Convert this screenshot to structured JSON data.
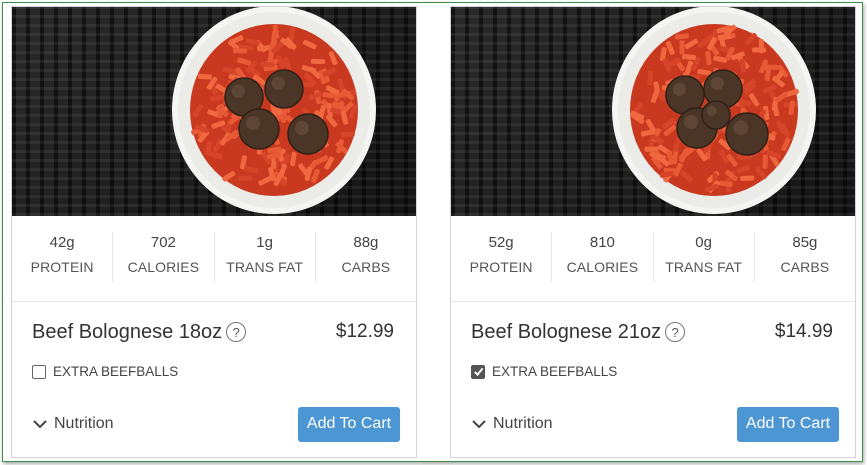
{
  "products": [
    {
      "stats": [
        {
          "value": "42g",
          "label": "PROTEIN"
        },
        {
          "value": "702",
          "label": "CALORIES"
        },
        {
          "value": "1g",
          "label": "TRANS FAT"
        },
        {
          "value": "88g",
          "label": "CARBS"
        }
      ],
      "name": "Beef Bolognese 18oz",
      "help_glyph": "?",
      "price": "$12.99",
      "option_label": "EXTRA BEEFBALLS",
      "option_checked": false,
      "nutrition_label": "Nutrition",
      "add_to_cart_label": "Add To Cart",
      "meatball_count": 4
    },
    {
      "stats": [
        {
          "value": "52g",
          "label": "PROTEIN"
        },
        {
          "value": "810",
          "label": "CALORIES"
        },
        {
          "value": "0g",
          "label": "TRANS FAT"
        },
        {
          "value": "85g",
          "label": "CARBS"
        }
      ],
      "name": "Beef Bolognese 21oz",
      "help_glyph": "?",
      "price": "$14.99",
      "option_label": "EXTRA BEEFBALLS",
      "option_checked": true,
      "nutrition_label": "Nutrition",
      "add_to_cart_label": "Add To Cart",
      "meatball_count": 5
    }
  ],
  "colors": {
    "button": "#4d96d4",
    "frame_border": "#3f8f4a",
    "sauce": "#d6452a",
    "meatball": "#4a3526"
  }
}
